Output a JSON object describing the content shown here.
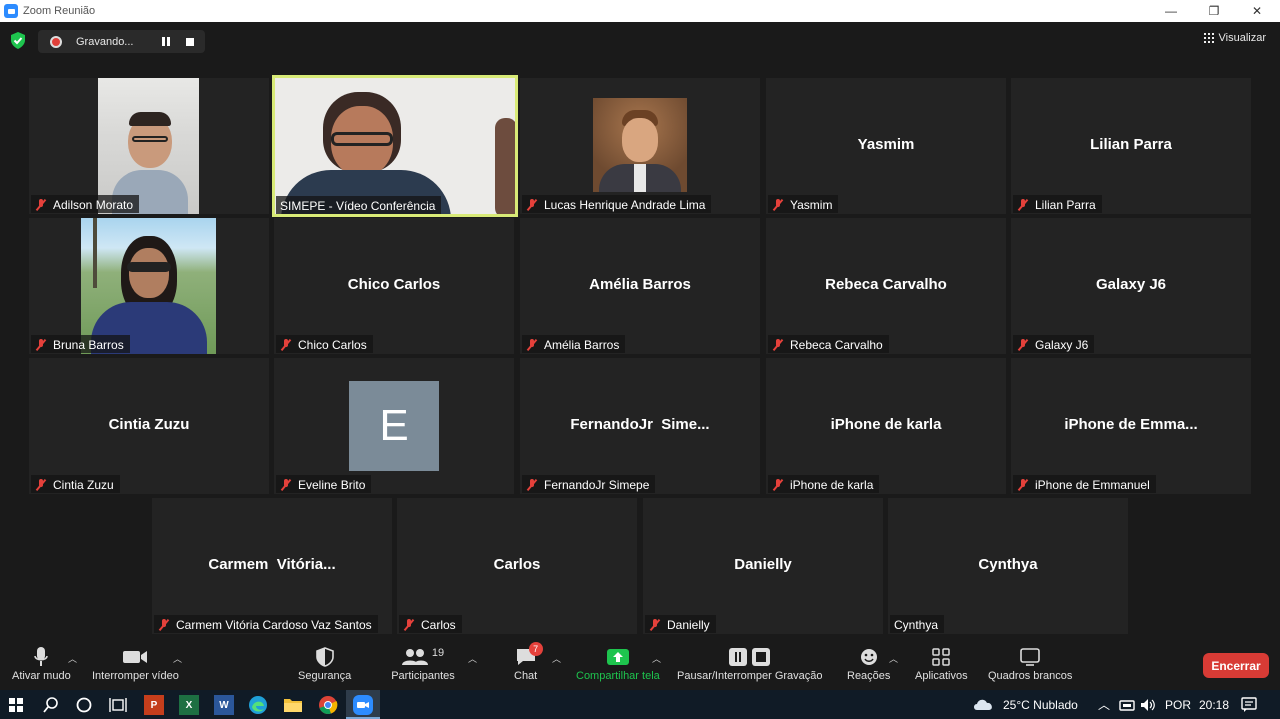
{
  "window": {
    "title": "Zoom Reunião",
    "minimize": "—",
    "restore": "❐",
    "close": "✕"
  },
  "recording": {
    "label": "Gravando..."
  },
  "view_button": {
    "label": "Visualizar"
  },
  "tiles": [
    {
      "label": "Adilson Morato"
    },
    {
      "label": "SIMEPE - Vídeo Conferência"
    },
    {
      "label": "Lucas Henrique Andrade Lima"
    },
    {
      "name": "Yasmim",
      "label": "Yasmim"
    },
    {
      "name": "Lilian Parra",
      "label": "Lilian Parra"
    },
    {
      "label": "Bruna Barros"
    },
    {
      "name": "Chico Carlos",
      "label": "Chico Carlos"
    },
    {
      "name": "Amélia Barros",
      "label": "Amélia Barros"
    },
    {
      "name": "Rebeca Carvalho",
      "label": "Rebeca Carvalho"
    },
    {
      "name": "Galaxy J6",
      "label": "Galaxy J6"
    },
    {
      "name": "Cintia Zuzu",
      "label": "Cintia Zuzu"
    },
    {
      "avatar_letter": "E",
      "label": "Eveline Brito"
    },
    {
      "name": "FernandoJr  Sime...",
      "label": "FernandoJr Simepe"
    },
    {
      "name": "iPhone de karla",
      "label": "iPhone de karla"
    },
    {
      "name": "iPhone de Emma...",
      "label": "iPhone de Emmanuel"
    },
    {
      "name": "Carmem  Vitória...",
      "label": "Carmem Vitória Cardoso Vaz Santos"
    },
    {
      "name": "Carlos",
      "label": "Carlos"
    },
    {
      "name": "Danielly",
      "label": "Danielly"
    },
    {
      "name": "Cynthya",
      "label": "Cynthya"
    }
  ],
  "toolbar": {
    "mute": "Ativar mudo",
    "video": "Interromper vídeo",
    "security": "Segurança",
    "participants": "Participantes",
    "participants_count": "19",
    "chat": "Chat",
    "chat_badge": "7",
    "share": "Compartilhar tela",
    "recording": "Pausar/Interromper Gravação",
    "reactions": "Reações",
    "apps": "Aplicativos",
    "whiteboards": "Quadros brancos",
    "end": "Encerrar"
  },
  "colors": {
    "share_green": "#1ec44e",
    "end_red": "#d83b35",
    "active_speaker": "#d8ea77",
    "tile_bg": "#232323"
  },
  "taskbar": {
    "apps": [
      "P",
      "X",
      "W"
    ],
    "weather": "25°C  Nublado",
    "language": "POR",
    "time": "20:18"
  }
}
